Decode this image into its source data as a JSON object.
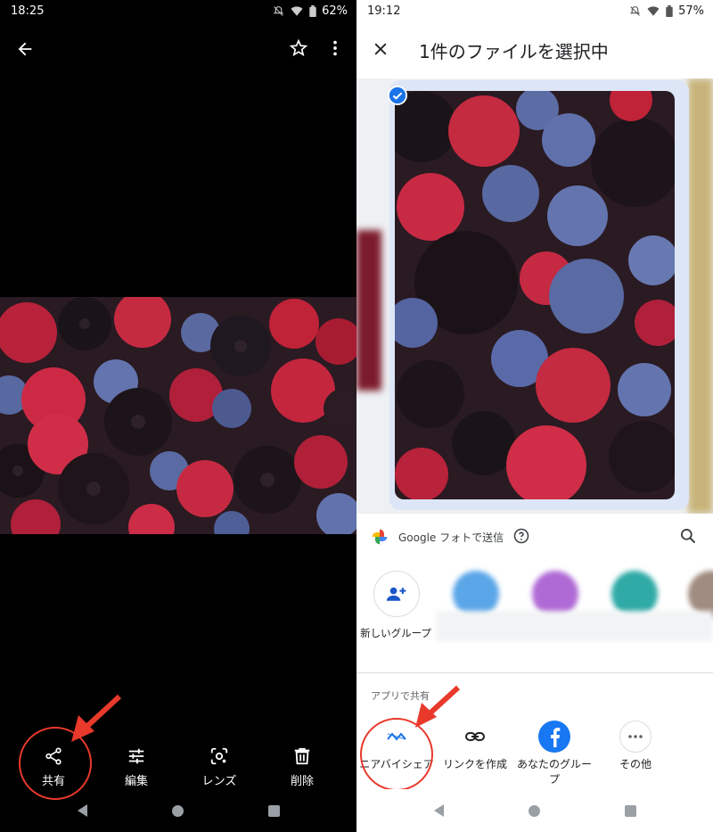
{
  "left": {
    "status": {
      "time": "18:25",
      "battery": "62%"
    },
    "actions": [
      {
        "label": "共有",
        "icon": "share-icon"
      },
      {
        "label": "編集",
        "icon": "tune-icon"
      },
      {
        "label": "レンズ",
        "icon": "lens-icon"
      },
      {
        "label": "削除",
        "icon": "trash-icon"
      }
    ]
  },
  "right": {
    "status": {
      "time": "19:12",
      "battery": "57%"
    },
    "title": "1件のファイルを選択中",
    "google_photos_label": "Google フォトで送信",
    "new_group_label": "新しいグループ",
    "app_share_label": "アプリで共有",
    "apps": [
      {
        "label": "ニアバイシェア",
        "icon": "nearby-share-icon"
      },
      {
        "label": "リンクを作成",
        "icon": "link-icon"
      },
      {
        "label": "あなたのグループ",
        "icon": "facebook-icon"
      },
      {
        "label": "その他",
        "icon": "more-icon"
      }
    ]
  },
  "colors": {
    "accent_red": "#e8392b",
    "google_blue": "#1a73e8",
    "facebook_blue": "#1877f2"
  }
}
